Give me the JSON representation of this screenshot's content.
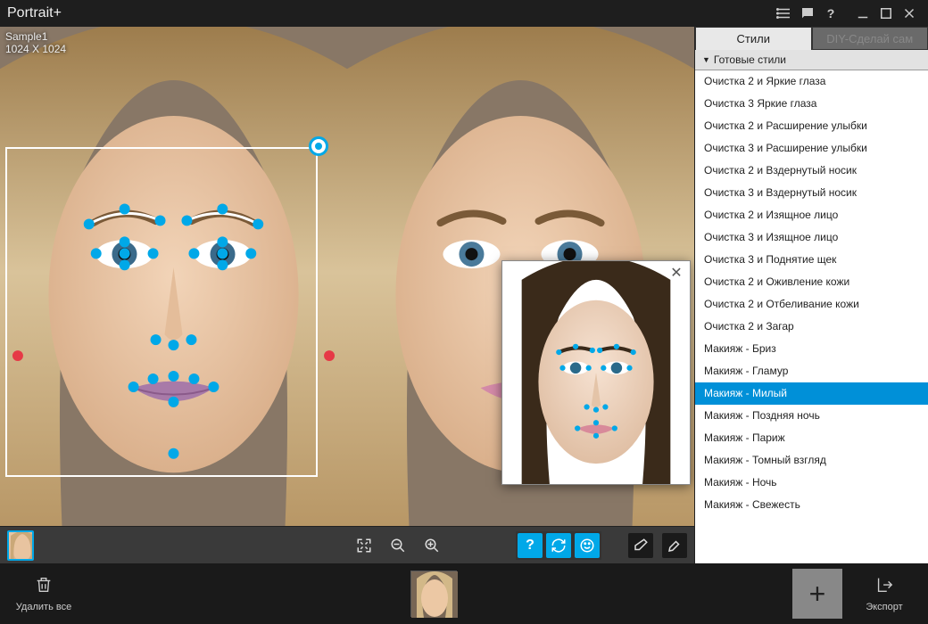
{
  "app": {
    "title": "Portrait+"
  },
  "image": {
    "name": "Sample1",
    "dimensions": "1024 X 1024"
  },
  "tabs": {
    "styles": "Стили",
    "diy": "DIY-Сделай сам"
  },
  "panel": {
    "header": "Готовые стили"
  },
  "styles": [
    "Очистка 2 и Яркие глаза",
    "Очистка 3 Яркие глаза",
    "Очистка 2 и Расширение улыбки",
    "Очистка 3 и Расширение улыбки",
    "Очистка 2 и Вздернутый носик",
    "Очистка 3 и Вздернутый носик",
    "Очистка 2 и Изящное лицо",
    "Очистка 3 и Изящное лицо",
    "Очистка 3 и Поднятие щек",
    "Очистка 2 и Оживление кожи",
    "Очистка 2 и Отбеливание кожи",
    "Очистка 2 и Загар",
    "Макияж - Бриз",
    "Макияж - Гламур",
    "Макияж - Милый",
    "Макияж - Поздняя ночь",
    "Макияж - Париж",
    "Макияж - Томный взгляд",
    "Макияж - Ночь",
    "Макияж - Свежесть"
  ],
  "selected_style_index": 14,
  "footer": {
    "delete_all": "Удалить все",
    "export": "Экспорт"
  },
  "colors": {
    "accent": "#00a8e8",
    "selection": "#0090d8"
  }
}
